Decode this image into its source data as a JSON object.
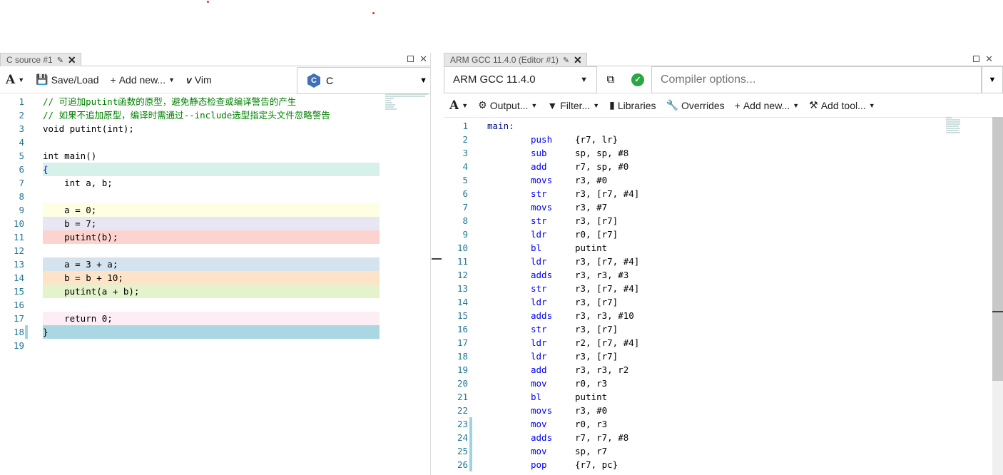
{
  "left_pane": {
    "tab_title": "C source #1",
    "toolbar": {
      "save_load": "Save/Load",
      "add_new": "Add new...",
      "vim": "Vim"
    },
    "language": "C",
    "lines": [
      {
        "n": "1",
        "text": "// 可追加putint函数的原型，避免静态检查或编译警告的产生",
        "bg": "#ffffff",
        "cls": "cm"
      },
      {
        "n": "2",
        "text": "// 如果不追加原型，编译时需通过--include选型指定头文件忽略警告",
        "bg": "#ffffff",
        "cls": "cm"
      },
      {
        "n": "3",
        "text": "void putint(int);",
        "bg": "#ffffff",
        "cls": "op"
      },
      {
        "n": "4",
        "text": "",
        "bg": "#ffffff",
        "cls": "op"
      },
      {
        "n": "5",
        "text": "int main()",
        "bg": "#ffffff",
        "cls": "op"
      },
      {
        "n": "6",
        "text": "{",
        "bg": "#d6f0ea",
        "cls": "kw"
      },
      {
        "n": "7",
        "text": "    int a, b;",
        "bg": "#ffffff",
        "cls": "op"
      },
      {
        "n": "8",
        "text": "",
        "bg": "#ffffff",
        "cls": "op"
      },
      {
        "n": "9",
        "text": "    a = 0;",
        "bg": "#fefee2",
        "cls": "op"
      },
      {
        "n": "10",
        "text": "    b = 7;",
        "bg": "#e8e6f2",
        "cls": "op"
      },
      {
        "n": "11",
        "text": "    putint(b);",
        "bg": "#fdd3cf",
        "cls": "op"
      },
      {
        "n": "12",
        "text": "",
        "bg": "#ffffff",
        "cls": "op"
      },
      {
        "n": "13",
        "text": "    a = 3 + a;",
        "bg": "#d5e3ef",
        "cls": "op"
      },
      {
        "n": "14",
        "text": "    b = b + 10;",
        "bg": "#fde3c7",
        "cls": "op"
      },
      {
        "n": "15",
        "text": "    putint(a + b);",
        "bg": "#e4f3cb",
        "cls": "op"
      },
      {
        "n": "16",
        "text": "",
        "bg": "#ffffff",
        "cls": "op"
      },
      {
        "n": "17",
        "text": "    return 0;",
        "bg": "#fdeef5",
        "cls": "op"
      },
      {
        "n": "18",
        "text": "}",
        "bg": "#abd7e4",
        "cls": "op"
      },
      {
        "n": "19",
        "text": "",
        "bg": "#ffffff",
        "cls": "op"
      }
    ]
  },
  "right_pane": {
    "tab_title": "ARM GCC 11.4.0 (Editor #1)",
    "compiler": "ARM GCC 11.4.0",
    "compiler_options_placeholder": "Compiler options...",
    "toolbar": {
      "output": "Output...",
      "filter": "Filter...",
      "libraries": "Libraries",
      "overrides": "Overrides",
      "add_new": "Add new...",
      "add_tool": "Add tool..."
    },
    "lines": [
      {
        "n": "1",
        "label": "main:",
        "mn": "",
        "ops": "",
        "bg": "#ffffff"
      },
      {
        "n": "2",
        "label": "",
        "mn": "push",
        "ops": "{r7, lr}",
        "bg": "#d6f0ea"
      },
      {
        "n": "3",
        "label": "",
        "mn": "sub",
        "ops": "sp, sp, #8",
        "bg": "#d6f0ea"
      },
      {
        "n": "4",
        "label": "",
        "mn": "add",
        "ops": "r7, sp, #0",
        "bg": "#d6f0ea"
      },
      {
        "n": "5",
        "label": "",
        "mn": "movs",
        "ops": "r3, #0",
        "bg": "#fefee2"
      },
      {
        "n": "6",
        "label": "",
        "mn": "str",
        "ops": "r3, [r7, #4]",
        "bg": "#fefee2"
      },
      {
        "n": "7",
        "label": "",
        "mn": "movs",
        "ops": "r3, #7",
        "bg": "#e8e6f2"
      },
      {
        "n": "8",
        "label": "",
        "mn": "str",
        "ops": "r3, [r7]",
        "bg": "#e8e6f2"
      },
      {
        "n": "9",
        "label": "",
        "mn": "ldr",
        "ops": "r0, [r7]",
        "bg": "#fdd3cf"
      },
      {
        "n": "10",
        "label": "",
        "mn": "bl",
        "ops": "putint",
        "bg": "#fdd3cf"
      },
      {
        "n": "11",
        "label": "",
        "mn": "ldr",
        "ops": "r3, [r7, #4]",
        "bg": "#d5e3ef"
      },
      {
        "n": "12",
        "label": "",
        "mn": "adds",
        "ops": "r3, r3, #3",
        "bg": "#d5e3ef"
      },
      {
        "n": "13",
        "label": "",
        "mn": "str",
        "ops": "r3, [r7, #4]",
        "bg": "#d5e3ef"
      },
      {
        "n": "14",
        "label": "",
        "mn": "ldr",
        "ops": "r3, [r7]",
        "bg": "#fde3c7"
      },
      {
        "n": "15",
        "label": "",
        "mn": "adds",
        "ops": "r3, r3, #10",
        "bg": "#fde3c7"
      },
      {
        "n": "16",
        "label": "",
        "mn": "str",
        "ops": "r3, [r7]",
        "bg": "#fde3c7"
      },
      {
        "n": "17",
        "label": "",
        "mn": "ldr",
        "ops": "r2, [r7, #4]",
        "bg": "#e4f3cb"
      },
      {
        "n": "18",
        "label": "",
        "mn": "ldr",
        "ops": "r3, [r7]",
        "bg": "#e4f3cb"
      },
      {
        "n": "19",
        "label": "",
        "mn": "add",
        "ops": "r3, r3, r2",
        "bg": "#e4f3cb"
      },
      {
        "n": "20",
        "label": "",
        "mn": "mov",
        "ops": "r0, r3",
        "bg": "#e4f3cb"
      },
      {
        "n": "21",
        "label": "",
        "mn": "bl",
        "ops": "putint",
        "bg": "#e4f3cb"
      },
      {
        "n": "22",
        "label": "",
        "mn": "movs",
        "ops": "r3, #0",
        "bg": "#fdeef5"
      },
      {
        "n": "23",
        "label": "",
        "mn": "mov",
        "ops": "r0, r3",
        "bg": "#f2f2f2"
      },
      {
        "n": "24",
        "label": "",
        "mn": "adds",
        "ops": "r7, r7, #8",
        "bg": "#f2f2f2"
      },
      {
        "n": "25",
        "label": "",
        "mn": "mov",
        "ops": "sp, r7",
        "bg": "#f2f2f2"
      },
      {
        "n": "26",
        "label": "",
        "mn": "pop",
        "ops": "{r7, pc}",
        "bg": "#f2f2f2"
      }
    ]
  }
}
